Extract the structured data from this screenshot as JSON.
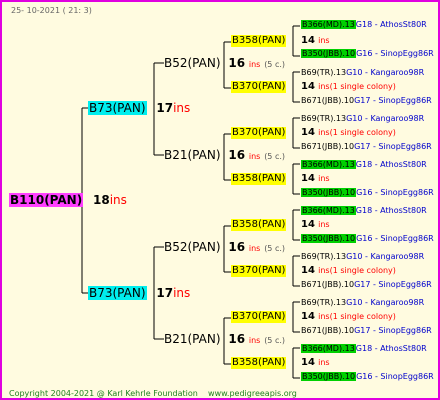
{
  "header": {
    "date": "25- 10-2021 ( 21: 3)"
  },
  "footer": {
    "copyright": "Copyright 2004-2021 @ Karl Kehrle Foundation",
    "website": "www.pedigreeapis.org"
  },
  "root": {
    "name": "B110(PAN)",
    "ins_num": "18",
    "ins_label": "ins"
  },
  "gen1": [
    {
      "name": "B73(PAN)",
      "ins_num": "17",
      "ins_label": "ins"
    },
    {
      "name": "B73(PAN)",
      "ins_num": "17",
      "ins_label": "ins"
    }
  ],
  "gen2": [
    {
      "name": "B52(PAN)",
      "ins_num": "16",
      "ins_label": "ins",
      "colonies": "(5 c.)"
    },
    {
      "name": "B21(PAN)",
      "ins_num": "16",
      "ins_label": "ins",
      "colonies": "(5 c.)"
    },
    {
      "name": "B52(PAN)",
      "ins_num": "16",
      "ins_label": "ins",
      "colonies": "(5 c.)"
    },
    {
      "name": "B21(PAN)",
      "ins_num": "16",
      "ins_label": "ins",
      "colonies": "(5 c.)"
    }
  ],
  "gen3": [
    {
      "name": "B358(PAN)",
      "ins_num": "14",
      "ins_label": "ins",
      "note": ""
    },
    {
      "name": "B370(PAN)",
      "ins_num": "14",
      "ins_label": "ins",
      "note": "(1 single colony)"
    },
    {
      "name": "B370(PAN)",
      "ins_num": "14",
      "ins_label": "ins",
      "note": "(1 single colony)"
    },
    {
      "name": "B358(PAN)",
      "ins_num": "14",
      "ins_label": "ins",
      "note": ""
    },
    {
      "name": "B358(PAN)",
      "ins_num": "14",
      "ins_label": "ins",
      "note": ""
    },
    {
      "name": "B370(PAN)",
      "ins_num": "14",
      "ins_label": "ins",
      "note": "(1 single colony)"
    },
    {
      "name": "B370(PAN)",
      "ins_num": "14",
      "ins_label": "ins",
      "note": "(1 single colony)"
    },
    {
      "name": "B358(PAN)",
      "ins_num": "14",
      "ins_label": "ins",
      "note": ""
    }
  ],
  "leaves": {
    "b366": {
      "code": "B366(MD).13",
      "gen": "G18",
      "rest": " - AthosSt80R"
    },
    "b350": {
      "code": "B350(JBB).10",
      "gen": "G16",
      "rest": " - SinopEgg86R"
    },
    "b69": {
      "code": "B69(TR).13",
      "gen": "G10",
      "rest": " - Kangaroo98R"
    },
    "b671": {
      "code": "B671(JBB).10",
      "gen": "G17",
      "rest": " - SinopEgg86R"
    }
  }
}
